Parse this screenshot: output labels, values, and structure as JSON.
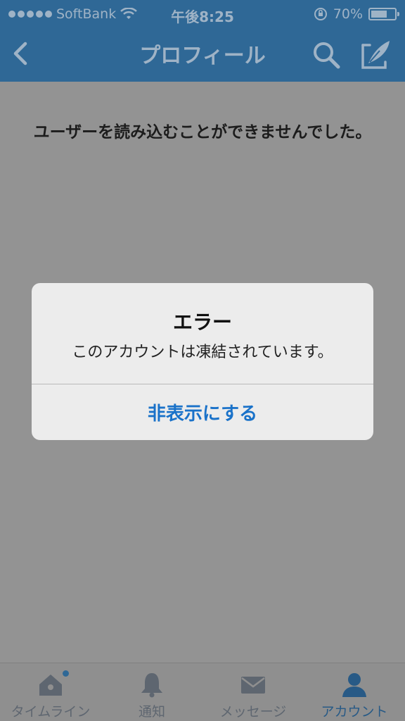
{
  "status_bar": {
    "carrier": "SoftBank",
    "time": "午後8:25",
    "battery": "70%",
    "battery_level": 0.7
  },
  "nav": {
    "title": "プロフィール",
    "icons": [
      "back-icon",
      "search-icon",
      "compose-icon"
    ]
  },
  "content": {
    "message": "ユーザーを読み込むことができませんでした。"
  },
  "alert": {
    "title": "エラー",
    "message": "このアカウントは凍結されています。",
    "button_label": "非表示にする"
  },
  "tab_bar": {
    "tabs": [
      {
        "label": "タイムライン",
        "icon": "home-icon",
        "has_badge": true
      },
      {
        "label": "通知",
        "icon": "bell-icon"
      },
      {
        "label": "メッセージ",
        "icon": "envelope-icon"
      },
      {
        "label": "アカウント",
        "icon": "person-icon",
        "active": true
      }
    ]
  },
  "colors": {
    "header": "#2f6896",
    "overlay": "#939393",
    "alert_background": "#ececec",
    "alert_button": "#1a72c9",
    "active_tab": "#285a86"
  }
}
